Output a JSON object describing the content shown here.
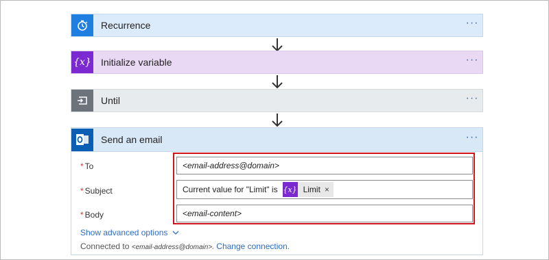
{
  "steps": [
    {
      "title": "Recurrence",
      "more": "···"
    },
    {
      "title": "Initialize variable",
      "icon_text": "{x}",
      "more": "···"
    },
    {
      "title": "Until",
      "more": "···"
    }
  ],
  "email": {
    "title": "Send an email",
    "more": "···",
    "required_mark": "*",
    "fields": {
      "to_label": "To",
      "to_value": "<email-address@domain>",
      "subject_label": "Subject",
      "subject_text": "Current value for \"Limit\" is",
      "subject_token_icon": "{x}",
      "subject_token": "Limit",
      "subject_token_remove": "×",
      "body_label": "Body",
      "body_value": "<email-content>"
    },
    "show_advanced": "Show advanced options",
    "connected_prefix": "Connected to",
    "connected_address": "<email-address@domain>.",
    "change_connection": "Change connection."
  },
  "colors": {
    "recurrence": "#1e7fe0",
    "variable": "#7b2ad1",
    "until": "#6d737a",
    "outlook": "#0a5fb4",
    "highlight": "#d0141d",
    "link": "#2b6cc4"
  }
}
